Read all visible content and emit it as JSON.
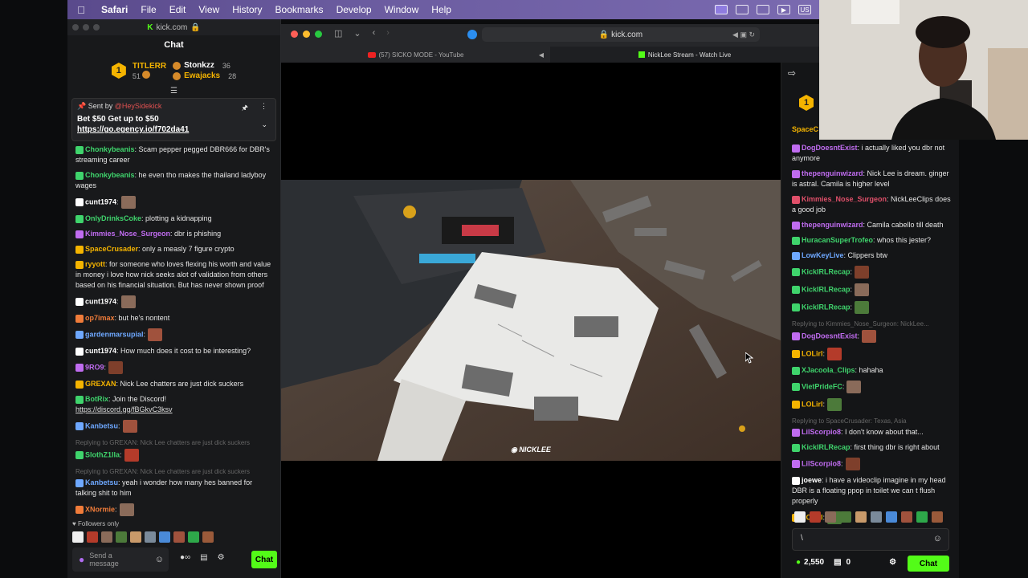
{
  "menubar": {
    "app": "Safari",
    "items": [
      "File",
      "Edit",
      "View",
      "History",
      "Bookmarks",
      "Develop",
      "Window",
      "Help"
    ],
    "lang": "US"
  },
  "left_window": {
    "address": "kick.com",
    "header": "Chat",
    "leaderboard": {
      "rank": "1",
      "top_name": "TITLERR",
      "top_count": "51",
      "others": [
        {
          "name": "Stonkzz",
          "count": "36"
        },
        {
          "name": "Ewajacks",
          "count": "28"
        }
      ]
    },
    "pinned": {
      "sent_by_label": "Sent by",
      "sender": "@HeySidekick",
      "promo": "Bet $50 Get up to $50",
      "link": "https://go.egency.io/f702da41"
    },
    "messages": [
      {
        "user": "Chonkybeanis",
        "color": "#3fd46c",
        "text": ": Scam pepper pegged DBR666 for DBR's streaming career"
      },
      {
        "user": "Chonkybeanis",
        "color": "#3fd46c",
        "text": ": he even tho makes the thailand ladyboy wages"
      },
      {
        "user": "cunt1974",
        "color": "#ffffff",
        "text": ":"
      },
      {
        "user": "OnlyDrinksCoke",
        "color": "#3fd46c",
        "text": ": plotting a kidnapping"
      },
      {
        "user": "Kimmies_Nose_Surgeon",
        "color": "#c06cf0",
        "text": ": dbr is phishing"
      },
      {
        "user": "SpaceCrusader",
        "color": "#f5b400",
        "text": ": only a measly 7 figure crypto"
      },
      {
        "user": "ryyott",
        "color": "#f5b400",
        "text": ": for someone who loves flexing his worth and value in money i love how nick seeks alot of validation from others based on his financial situation. But has never shown proof"
      },
      {
        "user": "cunt1974",
        "color": "#ffffff",
        "text": ":"
      },
      {
        "user": "op7imax",
        "color": "#f07c3a",
        "text": ": but he's nontent"
      },
      {
        "user": "gardenmarsupial",
        "color": "#6ea8ff",
        "text": ":"
      },
      {
        "user": "cunt1974",
        "color": "#ffffff",
        "text": ": How much does it cost to be interesting?"
      },
      {
        "user": "9RO9",
        "color": "#c06cf0",
        "text": ":"
      },
      {
        "user": "GREXAN",
        "color": "#f5b400",
        "text": ": Nick Lee chatters are just dick suckers"
      },
      {
        "user": "BotRix",
        "color": "#3fd46c",
        "text": ": Join the Discord!",
        "link": "https://discord.gg/fBGkvC3ksv"
      },
      {
        "user": "Kanbetsu",
        "color": "#6ea8ff",
        "text": ":"
      },
      {
        "reply": "Replying to GREXAN: Nick Lee chatters are just dick suckers",
        "user": "SlothZ1lla",
        "color": "#3fd46c",
        "text": ":"
      },
      {
        "reply": "Replying to GREXAN: Nick Lee chatters are just dick suckers",
        "user": "Kanbetsu",
        "color": "#6ea8ff",
        "text": ": yeah i wonder how many hes banned for talking shit to him"
      },
      {
        "user": "XNormie",
        "color": "#f07c3a",
        "text": ":"
      }
    ],
    "followers_only": "Followers only",
    "input_placeholder": "Send a message",
    "chat_button": "Chat"
  },
  "safari": {
    "address": "kick.com",
    "tabs": [
      "(57) SICKO MODE - YouTube",
      "NickLee Stream - Watch Live"
    ]
  },
  "video": {
    "watermark": "NICKLEE"
  },
  "right_chat": {
    "rank": "1",
    "cut_name": "SpaceC",
    "messages": [
      {
        "user": "DogDoesntExist",
        "color": "#c06cf0",
        "text": ": i actually liked you dbr not anymore"
      },
      {
        "user": "thepenguinwizard",
        "color": "#c06cf0",
        "text": ": Nick Lee is dream. ginger is astral. Camila is higher level"
      },
      {
        "user": "Kimmies_Nose_Surgeon",
        "color": "#e0506a",
        "text": ": NickLeeClips does a good job"
      },
      {
        "user": "thepenguinwizard",
        "color": "#c06cf0",
        "text": ": Camila cabello till death"
      },
      {
        "user": "HuracanSuperTrofeo",
        "color": "#3fd46c",
        "text": ": whos this jester?"
      },
      {
        "user": "LowKeyLive",
        "color": "#6ea8ff",
        "text": ": Clippers btw"
      },
      {
        "user": "KickIRLRecap",
        "color": "#3fd46c",
        "text": ":"
      },
      {
        "user": "KickIRLRecap",
        "color": "#3fd46c",
        "text": ":"
      },
      {
        "user": "KickIRLRecap",
        "color": "#3fd46c",
        "text": ":"
      },
      {
        "reply": "Replying to Kimmies_Nose_Surgeon: NickLee...",
        "user": "DogDoesntExist",
        "color": "#c06cf0",
        "text": ":"
      },
      {
        "user": "LOLirl",
        "color": "#f5b400",
        "text": ":"
      },
      {
        "user": "XJacoola_Clips",
        "color": "#3fd46c",
        "text": ": hahaha"
      },
      {
        "user": "VietPrideFC",
        "color": "#3fd46c",
        "text": ":"
      },
      {
        "user": "LOLirl",
        "color": "#f5b400",
        "text": ":"
      },
      {
        "reply": "Replying to SpaceCrusader: Texas, Asia",
        "user": "LilScorpio8",
        "color": "#c06cf0",
        "text": ": I don't know about that..."
      },
      {
        "user": "KickIRLRecap",
        "color": "#3fd46c",
        "text": ": first thing dbr is right about"
      },
      {
        "user": "LilScorpio8",
        "color": "#c06cf0",
        "text": ":"
      },
      {
        "user": "joewe",
        "color": "#ffffff",
        "text": ": i have a videoclip imagine in my head DBR is a floating ppop in toilet we can t flush properly"
      },
      {
        "user": "LOLirl",
        "color": "#f5b400",
        "text": ":"
      }
    ],
    "input_value": "\\",
    "points": "2,550",
    "drops": "0",
    "chat_button": "Chat"
  },
  "colors": {
    "kick_green": "#53fc18",
    "gold": "#f5b400"
  }
}
